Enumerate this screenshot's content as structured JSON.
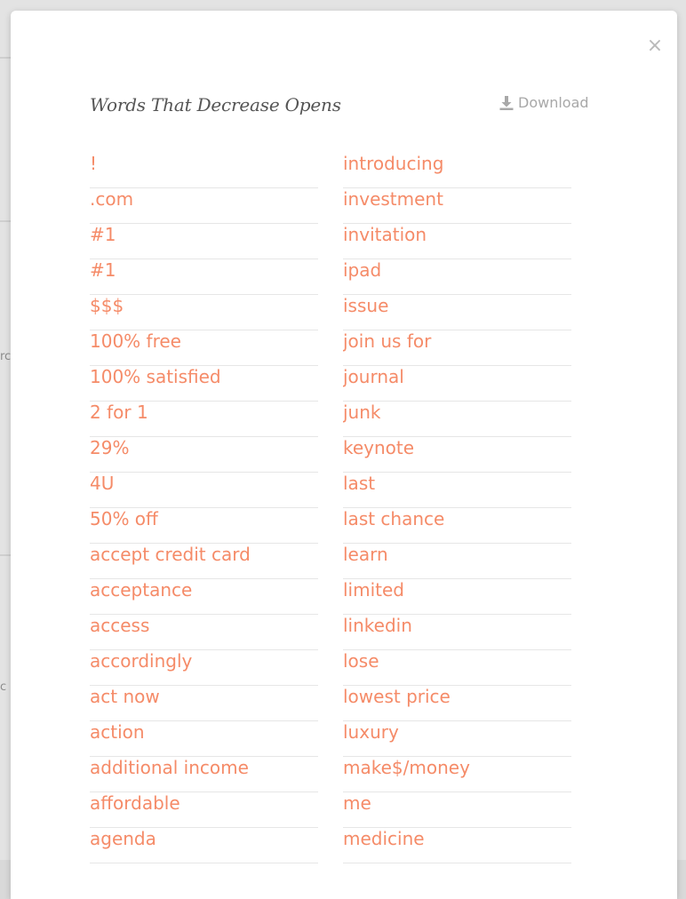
{
  "modal": {
    "title": "Words That Decrease Opens",
    "download_label": "Download",
    "close_glyph": "×"
  },
  "background": {
    "fragments": [
      "rc",
      "c"
    ]
  },
  "words": {
    "left": [
      "!",
      ".com",
      "#1",
      "#1",
      "$$$",
      "100% free",
      "100% satisfied",
      "2 for 1",
      "29%",
      "4U",
      "50% off",
      "accept credit card",
      "acceptance",
      "access",
      "accordingly",
      "act now",
      "action",
      "additional income",
      "affordable",
      "agenda"
    ],
    "right": [
      "introducing",
      "investment",
      "invitation",
      "ipad",
      "issue",
      "join us for",
      "journal",
      "junk",
      "keynote",
      "last",
      "last chance",
      "learn",
      "limited",
      "linkedin",
      "lose",
      "lowest price",
      "luxury",
      "make$/money",
      "me",
      "medicine"
    ]
  },
  "colors": {
    "word_accent": "#f58b68",
    "title_text": "#555555",
    "muted_text": "#a8a8a8",
    "row_divider": "#e6e6e6"
  },
  "icons": {
    "download": "download-icon",
    "close": "close-icon"
  }
}
